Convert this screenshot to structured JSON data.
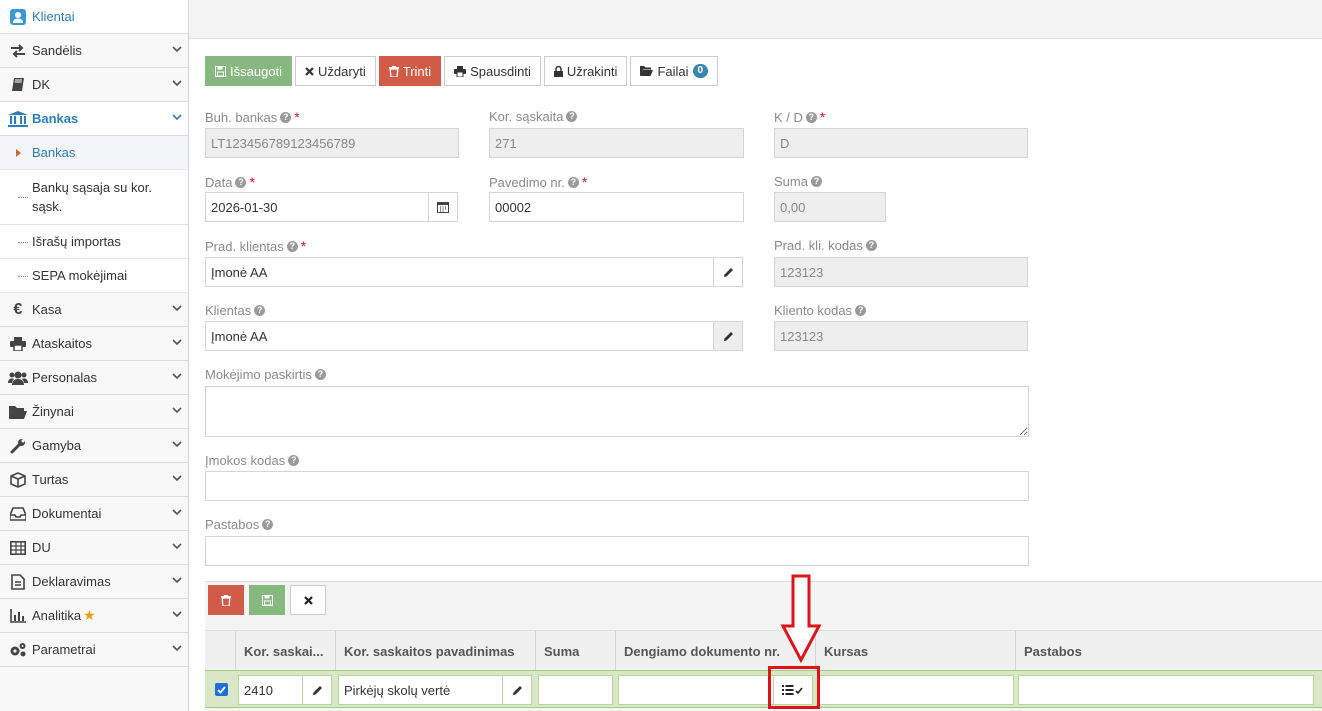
{
  "sidebar": {
    "items": [
      {
        "label": "Klientai",
        "icon": "user-icon"
      },
      {
        "label": "Sandėlis",
        "icon": "exchange-icon"
      },
      {
        "label": "DK",
        "icon": "book-icon"
      },
      {
        "label": "Bankas",
        "icon": "bank-icon"
      },
      {
        "label": "Kasa",
        "icon": "euro-icon"
      },
      {
        "label": "Ataskaitos",
        "icon": "printer-icon"
      },
      {
        "label": "Personalas",
        "icon": "users-icon"
      },
      {
        "label": "Žinynai",
        "icon": "folder-open-icon"
      },
      {
        "label": "Gamyba",
        "icon": "wrench-icon"
      },
      {
        "label": "Turtas",
        "icon": "cube-icon"
      },
      {
        "label": "Dokumentai",
        "icon": "inbox-icon"
      },
      {
        "label": "DU",
        "icon": "table-icon"
      },
      {
        "label": "Deklaravimas",
        "icon": "file-text-icon"
      },
      {
        "label": "Analitika",
        "icon": "bar-chart-icon"
      },
      {
        "label": "Parametrai",
        "icon": "cogs-icon"
      }
    ],
    "bankas_sub": [
      "Bankas",
      "Bankų sąsaja su kor. sąsk.",
      "Išrašų importas",
      "SEPA mokėjimai"
    ]
  },
  "toolbar": {
    "save": "Išsaugoti",
    "close": "Uždaryti",
    "delete": "Trinti",
    "print": "Spausdinti",
    "lock": "Užrakinti",
    "files": "Failai",
    "files_count": "0"
  },
  "form": {
    "buh_bankas": {
      "label": "Buh. bankas",
      "value": "LT123456789123456789"
    },
    "kor_saskaita": {
      "label": "Kor. sąskaita",
      "value": "271"
    },
    "kd": {
      "label": "K / D",
      "value": "D"
    },
    "data": {
      "label": "Data",
      "value": "2026-01-30"
    },
    "pavedimo_nr": {
      "label": "Pavedimo nr.",
      "value": "00002"
    },
    "suma": {
      "label": "Suma",
      "value": "0,00"
    },
    "prad_klientas": {
      "label": "Prad. klientas",
      "value": "Įmonė AA"
    },
    "prad_kli_kodas": {
      "label": "Prad. kli. kodas",
      "value": "123123"
    },
    "klientas": {
      "label": "Klientas",
      "value": "Įmonė AA"
    },
    "kliento_kodas": {
      "label": "Kliento kodas",
      "value": "123123"
    },
    "mokejimo_paskirtis": {
      "label": "Mokėjimo paskirtis",
      "value": ""
    },
    "imokos_kodas": {
      "label": "Įmokos kodas",
      "value": ""
    },
    "pastabos": {
      "label": "Pastabos",
      "value": ""
    }
  },
  "grid": {
    "headers": [
      "Kor. saskai...",
      "Kor. saskaitos pavadinimas",
      "Suma",
      "Dengiamo dokumento nr.",
      "Kursas",
      "Pastabos"
    ],
    "row": {
      "checked": true,
      "kor_saskaita": "2410",
      "pavadinimas": "Pirkėjų skolų vertė",
      "suma": "",
      "dengiamo": "",
      "kursas": "",
      "pastabos": ""
    }
  },
  "colors": {
    "accent": "#2b7dbc",
    "success": "#87b87f",
    "danger": "#d15b47",
    "highlight": "#e0121a"
  }
}
